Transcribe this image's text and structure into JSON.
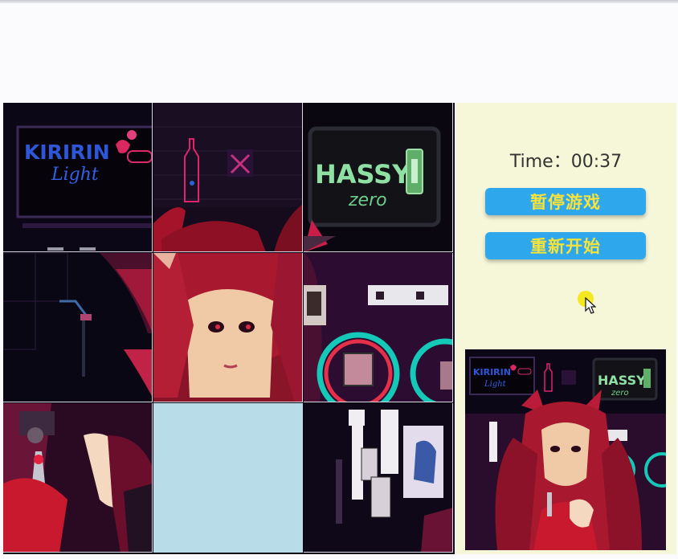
{
  "timer": {
    "label": "Time：",
    "value": "00:37"
  },
  "controls": {
    "pause_label": "暂停游戏",
    "restart_label": "重新开始"
  },
  "artwork": {
    "sign_left_top": "KIRIRIN",
    "sign_left_script": "Light",
    "sign_right_top": "HASSY",
    "sign_right_bottom": "zero"
  },
  "puzzle": {
    "grid_size": 3,
    "empty_slot_index": 7
  },
  "colors": {
    "panel_bg": "#f6f6d9",
    "button_bg": "#2ea7ec",
    "button_text": "#f7e23a",
    "empty_tile": "#b8dde8"
  }
}
